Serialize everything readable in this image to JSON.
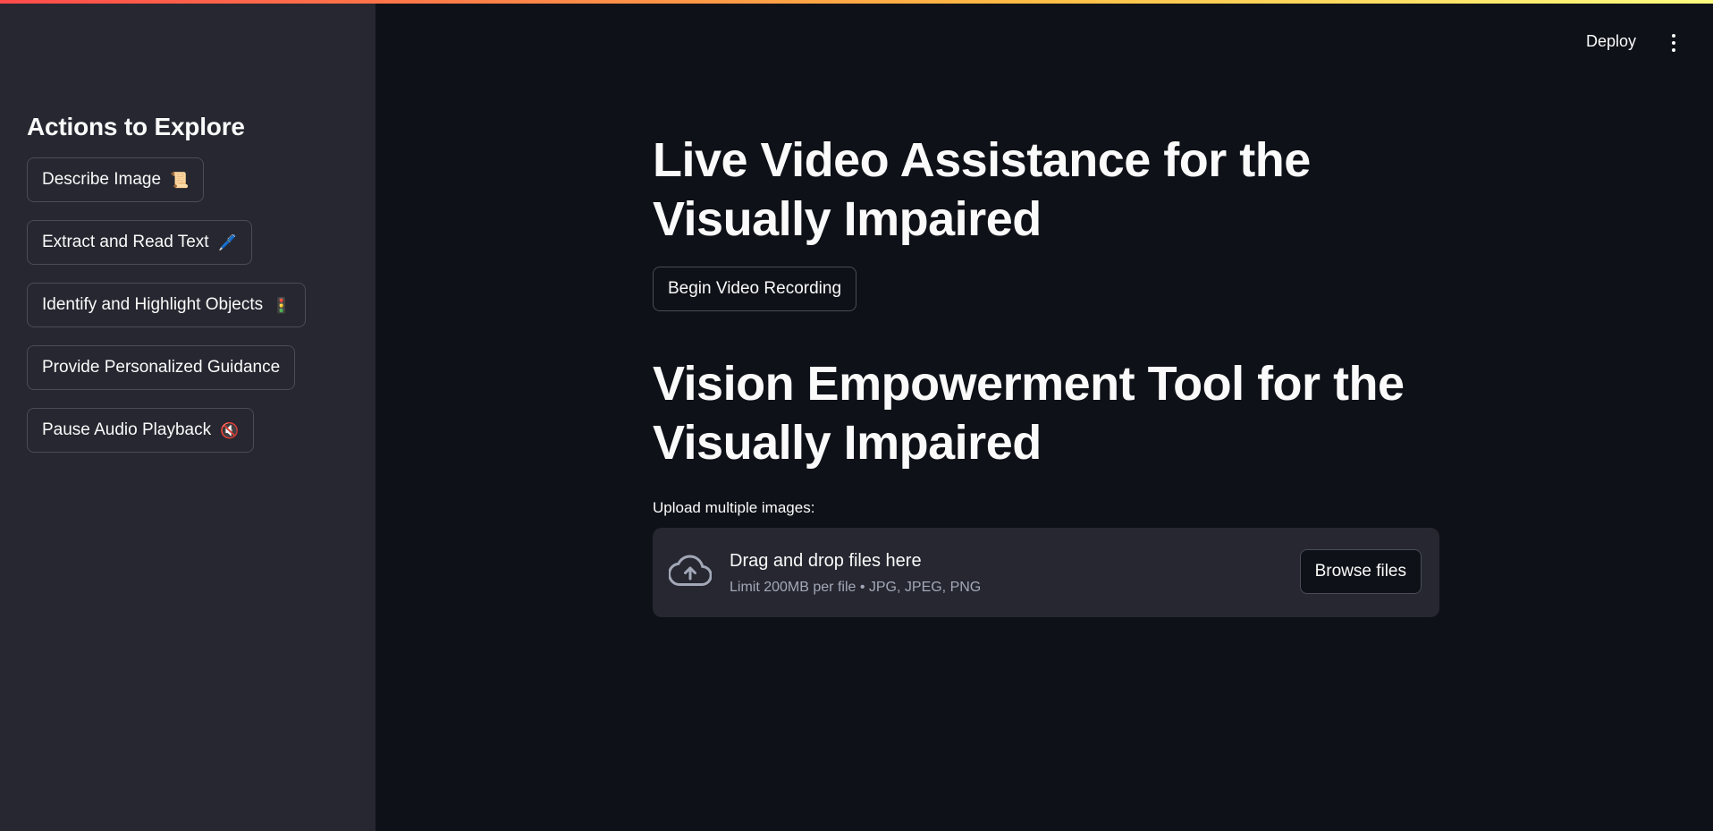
{
  "header": {
    "deploy_label": "Deploy",
    "menu_icon": "kebab-menu-icon"
  },
  "sidebar": {
    "title": "Actions to Explore",
    "buttons": [
      {
        "label": "Describe Image",
        "emoji": "📜"
      },
      {
        "label": "Extract and Read Text",
        "emoji": "🖊️"
      },
      {
        "label": "Identify and Highlight Objects",
        "emoji": "🚦"
      },
      {
        "label": "Provide Personalized Guidance",
        "emoji": ""
      },
      {
        "label": "Pause Audio Playback",
        "emoji": "🔇"
      }
    ]
  },
  "main": {
    "title_video": "Live Video Assistance for the Visually Impaired",
    "video_button_label": "Begin Video Recording",
    "title_tool": "Vision Empowerment Tool for the Visually Impaired",
    "upload_label": "Upload multiple images:",
    "dropzone": {
      "icon": "cloud-upload-icon",
      "title": "Drag and drop files here",
      "subtitle": "Limit 200MB per file • JPG, JPEG, PNG",
      "browse_label": "Browse files"
    }
  },
  "colors": {
    "background": "#0e1117",
    "sidebar": "#262730",
    "text": "#fafafa",
    "muted_text": "#a3a8b8",
    "border": "#4a4c57",
    "accent_gradient_start": "#ff4b4b",
    "accent_gradient_end": "#fffd80"
  }
}
